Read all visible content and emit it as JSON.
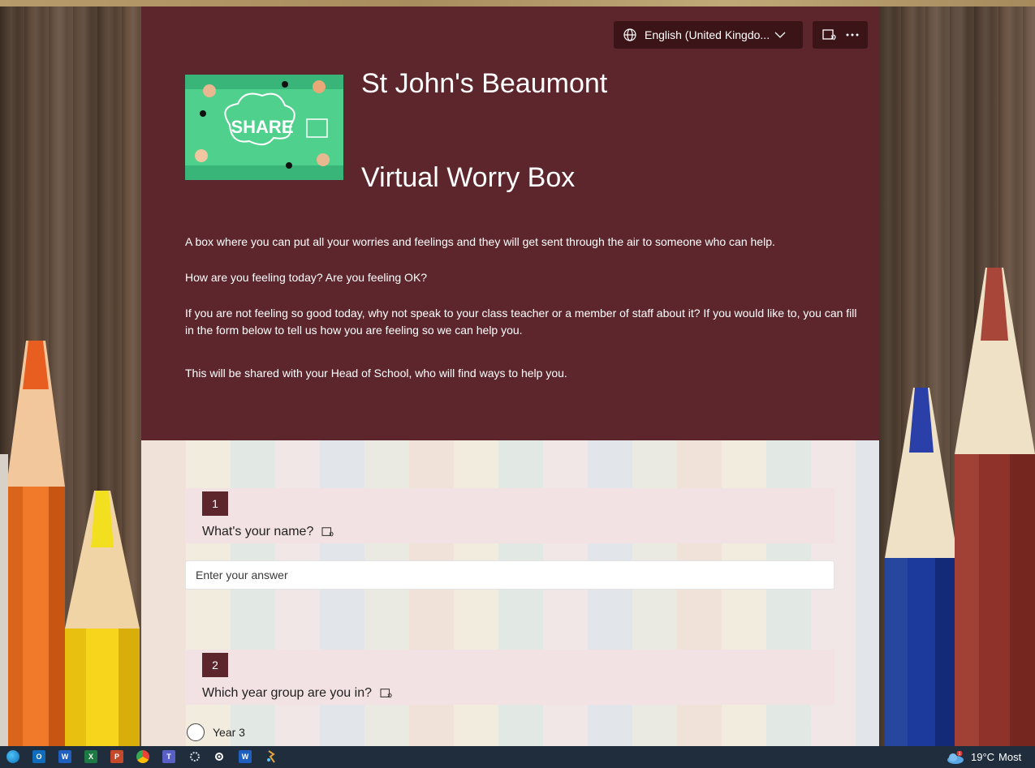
{
  "language_selector": {
    "label": "English (United Kingdo..."
  },
  "header": {
    "title_line1": "St John's Beaumont",
    "title_line2": "Virtual Worry Box",
    "image_text": "SHARE",
    "description": [
      "A box where you can put all your worries and feelings and they will get sent through the air to someone who can help.",
      "How are you feeling today? Are you feeling OK?",
      "If you are not feeling so good today, why not speak to your class teacher or a member of staff about it? If you would like to, you can fill in the form below to tell us how you are feeling so we can help you.",
      "This will be shared with your Head of School, who will find ways to help you."
    ]
  },
  "questions": [
    {
      "number": "1",
      "text": "What's your name?",
      "placeholder": "Enter your answer"
    },
    {
      "number": "2",
      "text": "Which year group are you in?",
      "options": [
        "Year 3"
      ]
    }
  ],
  "taskbar": {
    "icons": [
      "edge-icon",
      "outlook-icon",
      "word-icon",
      "excel-icon",
      "powerpoint-icon",
      "chrome-icon",
      "teams-icon",
      "settings-app-icon",
      "gear-icon",
      "word-icon",
      "app-icon"
    ],
    "weather": {
      "temp": "19°C",
      "condition": "Most",
      "badge": "1"
    }
  },
  "colors": {
    "header_bg": "#5c262c",
    "button_bg": "#3b1418",
    "question_bg": "#f2e2e3"
  }
}
